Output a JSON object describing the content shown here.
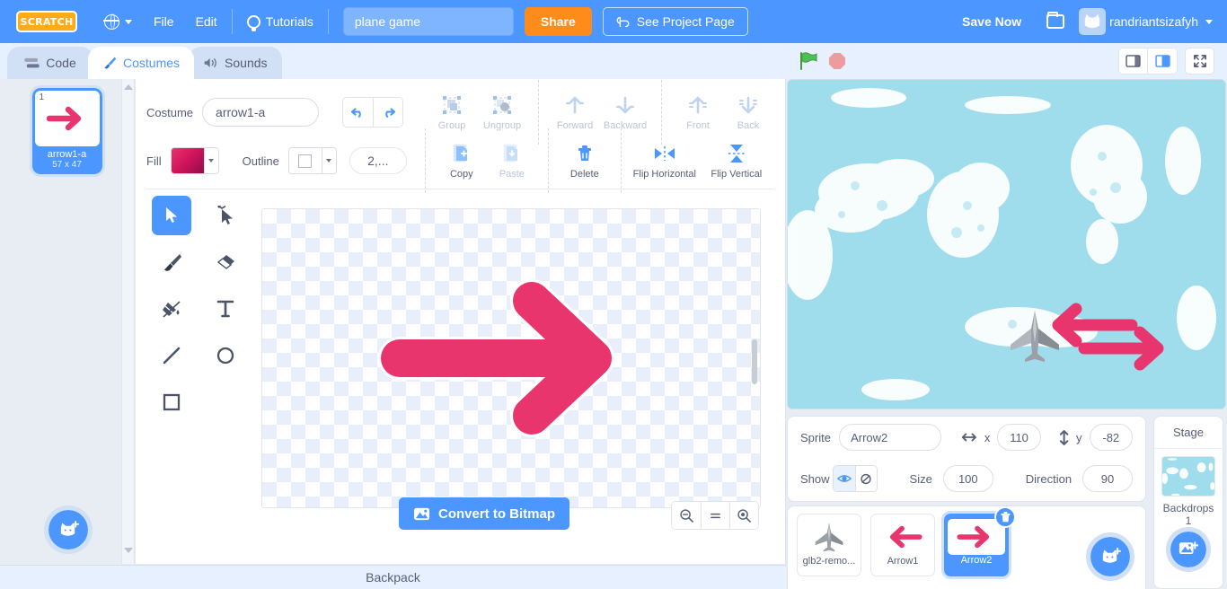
{
  "menubar": {
    "logo": "SCRATCH",
    "language_icon": "globe-icon",
    "file": "File",
    "edit": "Edit",
    "tutorials": "Tutorials",
    "tutorials_icon": "lightbulb-icon",
    "project_title": "plane game",
    "project_title_placeholder": "Project title",
    "share": "Share",
    "see_project_page": "See Project Page",
    "see_project_icon": "remix-icon",
    "save_now": "Save Now",
    "folder_icon": "folder-icon",
    "username": "randriantsizafyh",
    "avatar_icon": "cat-avatar-icon",
    "account_caret": "chevron-down-icon"
  },
  "tabs": [
    {
      "label": "Code",
      "icon": "code-blocks-icon",
      "active": false
    },
    {
      "label": "Costumes",
      "icon": "paintbrush-icon",
      "active": true
    },
    {
      "label": "Sounds",
      "icon": "speaker-icon",
      "active": false
    }
  ],
  "costume_list": {
    "items": [
      {
        "number": "1",
        "name": "arrow1-a",
        "size": "57 x 47",
        "selected": true
      }
    ],
    "add_button_icon": "add-costume-cat-icon"
  },
  "paint_editor": {
    "costume_label": "Costume",
    "costume_name": "arrow1-a",
    "costume_name_placeholder": "Costume name",
    "undo_icon": "undo-arrow-icon",
    "redo_icon": "redo-arrow-icon",
    "fill_label": "Fill",
    "fill_color": "#d4155c",
    "outline_label": "Outline",
    "outline_color": "#ffffff",
    "stroke_width": "2,...",
    "actions": [
      {
        "label": "Group",
        "icon": "group-icon",
        "disabled": true
      },
      {
        "label": "Ungroup",
        "icon": "ungroup-icon",
        "disabled": true
      },
      {
        "label": "Forward",
        "icon": "forward-arrow-icon",
        "disabled": true
      },
      {
        "label": "Backward",
        "icon": "backward-arrow-icon",
        "disabled": true
      },
      {
        "label": "Front",
        "icon": "front-arrow-icon",
        "disabled": true
      },
      {
        "label": "Back",
        "icon": "back-arrow-icon",
        "disabled": true
      },
      {
        "label": "Copy",
        "icon": "copy-icon",
        "disabled": false
      },
      {
        "label": "Paste",
        "icon": "paste-icon",
        "disabled": true
      },
      {
        "label": "Delete",
        "icon": "trash-icon",
        "disabled": false
      },
      {
        "label": "Flip Horizontal",
        "icon": "flip-horizontal-icon",
        "disabled": false
      },
      {
        "label": "Flip Vertical",
        "icon": "flip-vertical-icon",
        "disabled": false
      }
    ],
    "tools": [
      {
        "name": "select",
        "icon": "arrow-cursor-icon",
        "selected": true
      },
      {
        "name": "reshape",
        "icon": "reshape-node-icon",
        "selected": false
      },
      {
        "name": "brush",
        "icon": "paintbrush-tool-icon",
        "selected": false
      },
      {
        "name": "eraser",
        "icon": "eraser-icon",
        "selected": false
      },
      {
        "name": "fill",
        "icon": "paint-bucket-icon",
        "selected": false
      },
      {
        "name": "text",
        "icon": "text-t-icon",
        "selected": false
      },
      {
        "name": "line",
        "icon": "line-icon",
        "selected": false
      },
      {
        "name": "circle",
        "icon": "circle-icon",
        "selected": false
      },
      {
        "name": "rectangle",
        "icon": "rectangle-icon",
        "selected": false
      }
    ],
    "convert_button": "Convert to Bitmap",
    "convert_icon": "image-icon",
    "zoom_out_icon": "zoom-out-icon",
    "zoom_reset_icon": "zoom-reset-icon",
    "zoom_in_icon": "zoom-in-icon"
  },
  "backpack": {
    "label": "Backpack"
  },
  "stage_controls": {
    "green_flag_icon": "green-flag-icon",
    "stop_icon": "stop-sign-icon",
    "small_stage_icon": "small-stage-icon",
    "large_stage_icon": "large-stage-icon",
    "fullscreen_icon": "fullscreen-icon"
  },
  "sprite_info": {
    "sprite_label": "Sprite",
    "sprite_name": "Arrow2",
    "sprite_name_placeholder": "Sprite name",
    "x_label": "x",
    "x_value": "110",
    "x_icon": "horizontal-arrows-icon",
    "y_label": "y",
    "y_value": "-82",
    "y_icon": "vertical-arrows-icon",
    "show_label": "Show",
    "show_on_icon": "eye-icon",
    "show_off_icon": "eye-slash-icon",
    "show_value": "visible",
    "size_label": "Size",
    "size_value": "100",
    "direction_label": "Direction",
    "direction_value": "90"
  },
  "sprites": [
    {
      "name": "glb2-remo...",
      "icon": "jet-plane-icon",
      "selected": false
    },
    {
      "name": "Arrow1",
      "icon": "left-arrow-icon",
      "selected": false
    },
    {
      "name": "Arrow2",
      "icon": "right-arrow-icon",
      "selected": true
    }
  ],
  "sprite_add": {
    "icon": "add-sprite-cat-icon"
  },
  "stage_pane": {
    "title": "Stage",
    "backdrops_label": "Backdrops",
    "backdrops_count": "1",
    "add_backdrop_icon": "add-backdrop-image-icon"
  },
  "colors": {
    "brand_blue": "#4c97ff",
    "accent_orange": "#ff8c1a",
    "pink": "#e8356d",
    "stage_sky": "#9fddec",
    "panel_bg": "#e6f0ff"
  }
}
